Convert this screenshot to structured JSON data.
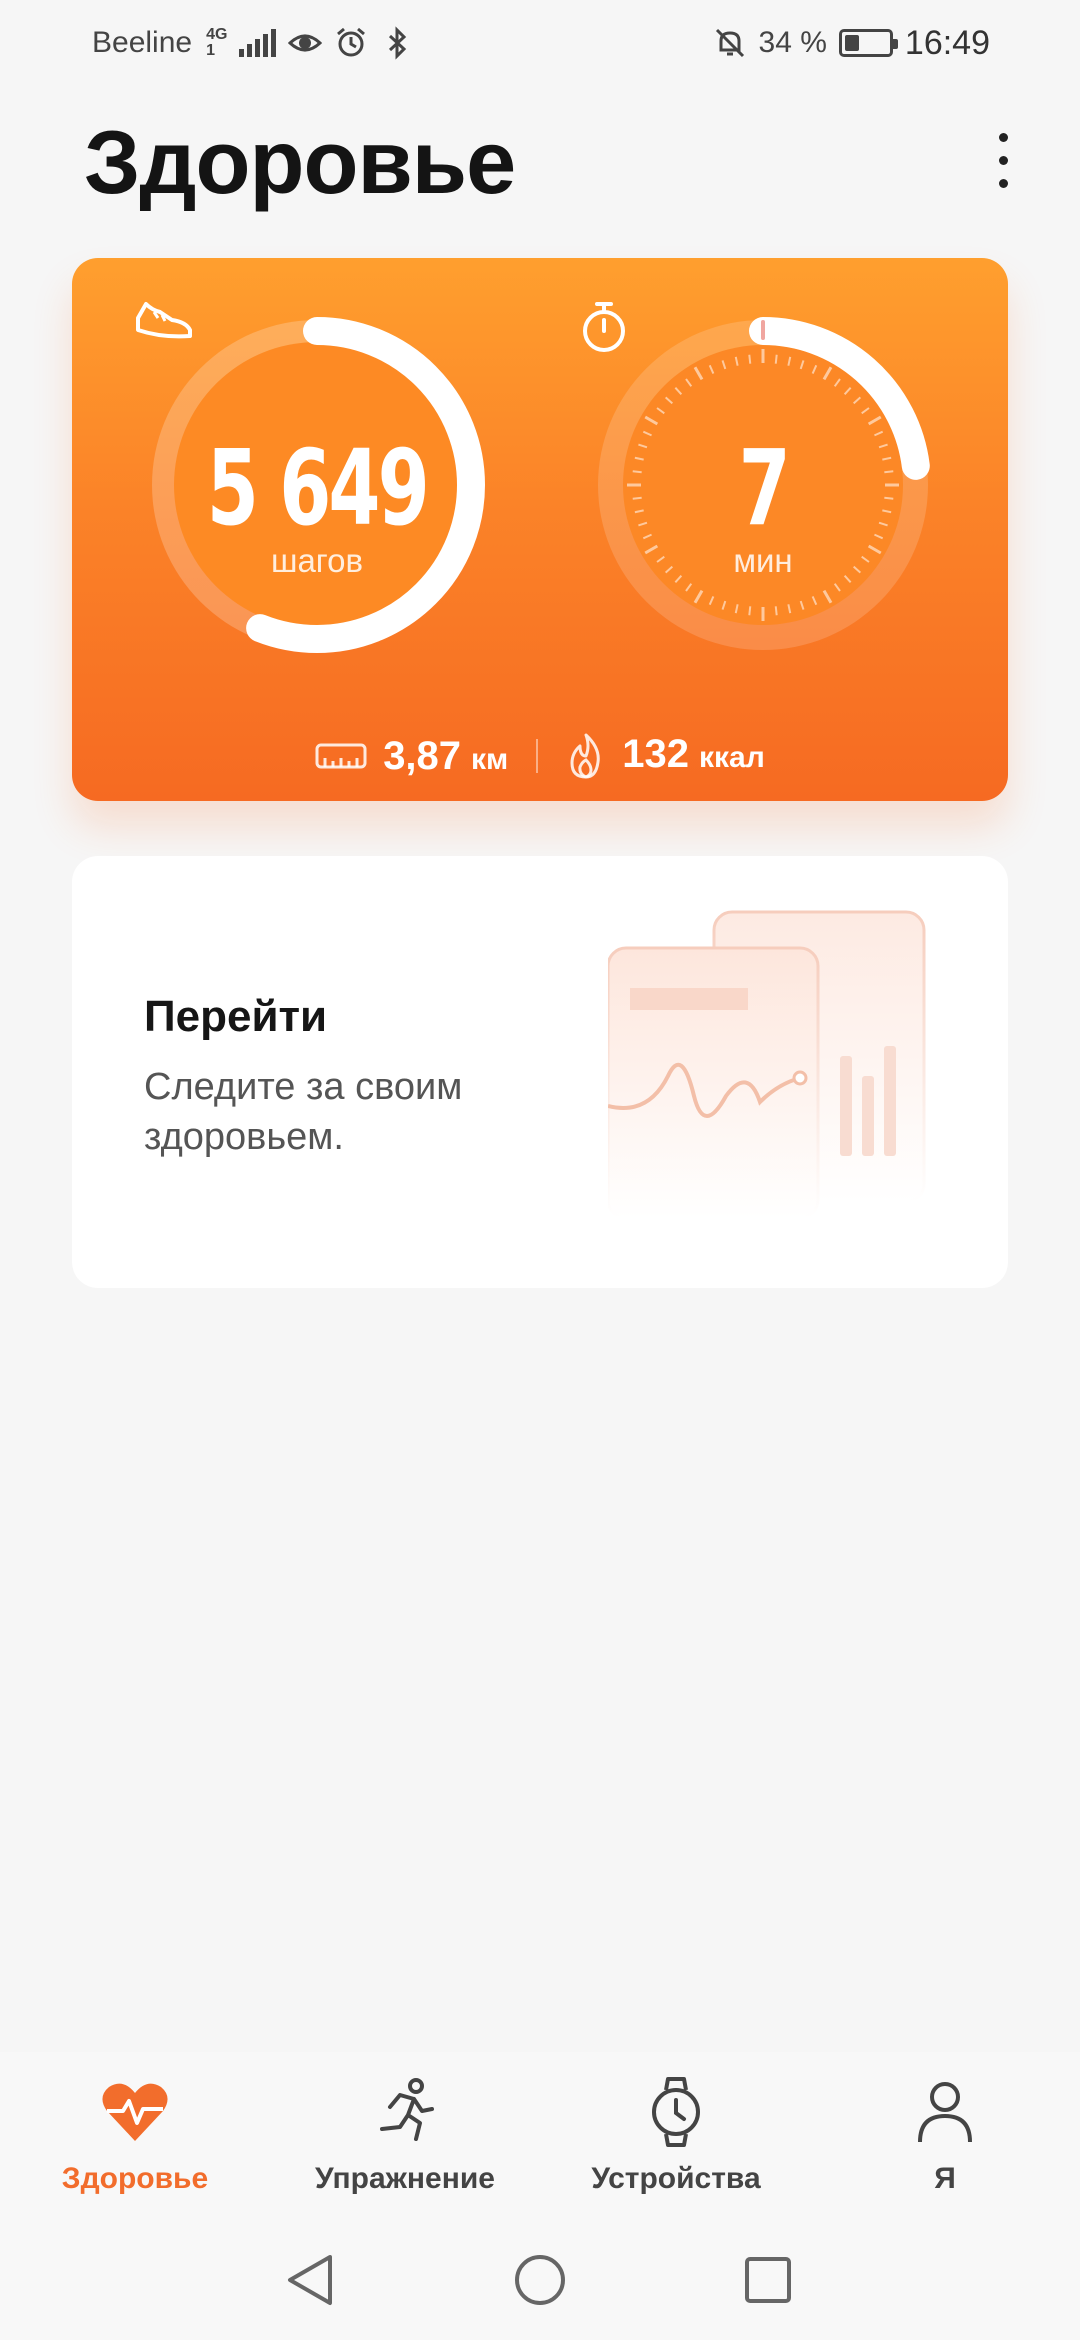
{
  "status_bar": {
    "carrier": "Beeline",
    "network_top": "4G",
    "network_bottom": "1",
    "battery_text": "34 %",
    "battery_level": 0.34,
    "time": "16:49",
    "icons": [
      "signal-icon",
      "eye-icon",
      "alarm-icon",
      "bluetooth-icon",
      "bell-off-icon",
      "battery-icon"
    ]
  },
  "header": {
    "title": "Здоровье",
    "menu_icon": "more-vertical-icon"
  },
  "activity": {
    "steps": {
      "value": "5 649",
      "unit": "шагов",
      "icon": "sneaker-icon",
      "progress": 0.56
    },
    "minutes": {
      "value": "7",
      "unit": "мин",
      "icon": "stopwatch-icon",
      "progress": 0.23
    },
    "distance": {
      "value": "3,87",
      "unit": "км",
      "icon": "ruler-icon"
    },
    "calories": {
      "value": "132",
      "unit": "ккал",
      "icon": "flame-icon"
    },
    "colors": {
      "gradient_top": "#ff9f2e",
      "gradient_bottom": "#f66a22"
    }
  },
  "promo": {
    "title": "Перейти",
    "text": "Следите за своим здоровьем.",
    "illustration": "health-chart-illustration"
  },
  "bottom_nav": {
    "accent": "#f26d2c",
    "items": [
      {
        "label": "Здоровье",
        "icon": "heart-pulse-icon",
        "active": true
      },
      {
        "label": "Упражнение",
        "icon": "running-icon",
        "active": false
      },
      {
        "label": "Устройства",
        "icon": "watch-icon",
        "active": false
      },
      {
        "label": "Я",
        "icon": "person-icon",
        "active": false
      }
    ]
  },
  "system_nav": {
    "icons": [
      "back-icon",
      "home-icon",
      "recents-icon"
    ]
  }
}
